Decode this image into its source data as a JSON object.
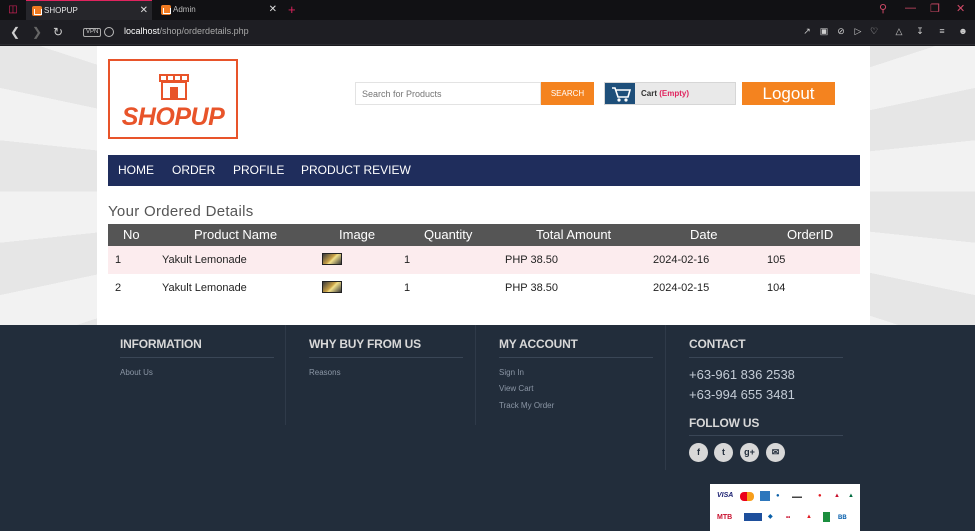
{
  "browser": {
    "tabs": [
      {
        "label": "SHOPUP",
        "active": true
      },
      {
        "label": "Admin",
        "active": false
      }
    ],
    "vpn_label": "VPN",
    "url_host": "localhost",
    "url_path": "/shop/orderdetails.php"
  },
  "header": {
    "logo_text": "SHOPUP",
    "search_placeholder": "Search for Products",
    "search_button": "SEARCH",
    "cart_label": "Cart",
    "cart_status": "(Empty)",
    "logout_label": "Logout"
  },
  "menu": {
    "items": [
      "HOME",
      "ORDER",
      "PROFILE",
      "PRODUCT REVIEW"
    ]
  },
  "orders": {
    "title": "Your Ordered Details",
    "columns": [
      "No",
      "Product Name",
      "Image",
      "Quantity",
      "Total Amount",
      "Date",
      "OrderID"
    ],
    "rows": [
      {
        "no": "1",
        "product": "Yakult Lemonade",
        "quantity": "1",
        "total": "PHP 38.50",
        "date": "2024-02-16",
        "order_id": "105"
      },
      {
        "no": "2",
        "product": "Yakult Lemonade",
        "quantity": "1",
        "total": "PHP 38.50",
        "date": "2024-02-15",
        "order_id": "104"
      }
    ]
  },
  "footer": {
    "information": {
      "title": "INFORMATION",
      "links": [
        "About Us"
      ]
    },
    "why_buy": {
      "title": "WHY BUY FROM US",
      "links": [
        "Reasons"
      ]
    },
    "my_account": {
      "title": "MY ACCOUNT",
      "links": [
        "Sign In",
        "View Cart",
        "Track My Order"
      ]
    },
    "contact": {
      "title": "CONTACT",
      "phones": [
        "+63-961 836 2538",
        "+63-994 655 3481"
      ],
      "follow_title": "FOLLOW US",
      "social_icons": [
        "facebook-icon",
        "twitter-icon",
        "google-plus-icon",
        "email-icon"
      ]
    },
    "payment_logos": [
      "VISA",
      "MC",
      "AMEX",
      "CIRRUS",
      "BANK",
      "MTB",
      "BB"
    ]
  },
  "colors": {
    "accent_orange": "#f4831f",
    "logo_orange": "#e8542a",
    "menu_navy": "#1f2d5c",
    "footer_bg": "#222d3b",
    "table_head": "#555555",
    "row_highlight": "#fcecee",
    "browser_accent": "#e0245e"
  }
}
